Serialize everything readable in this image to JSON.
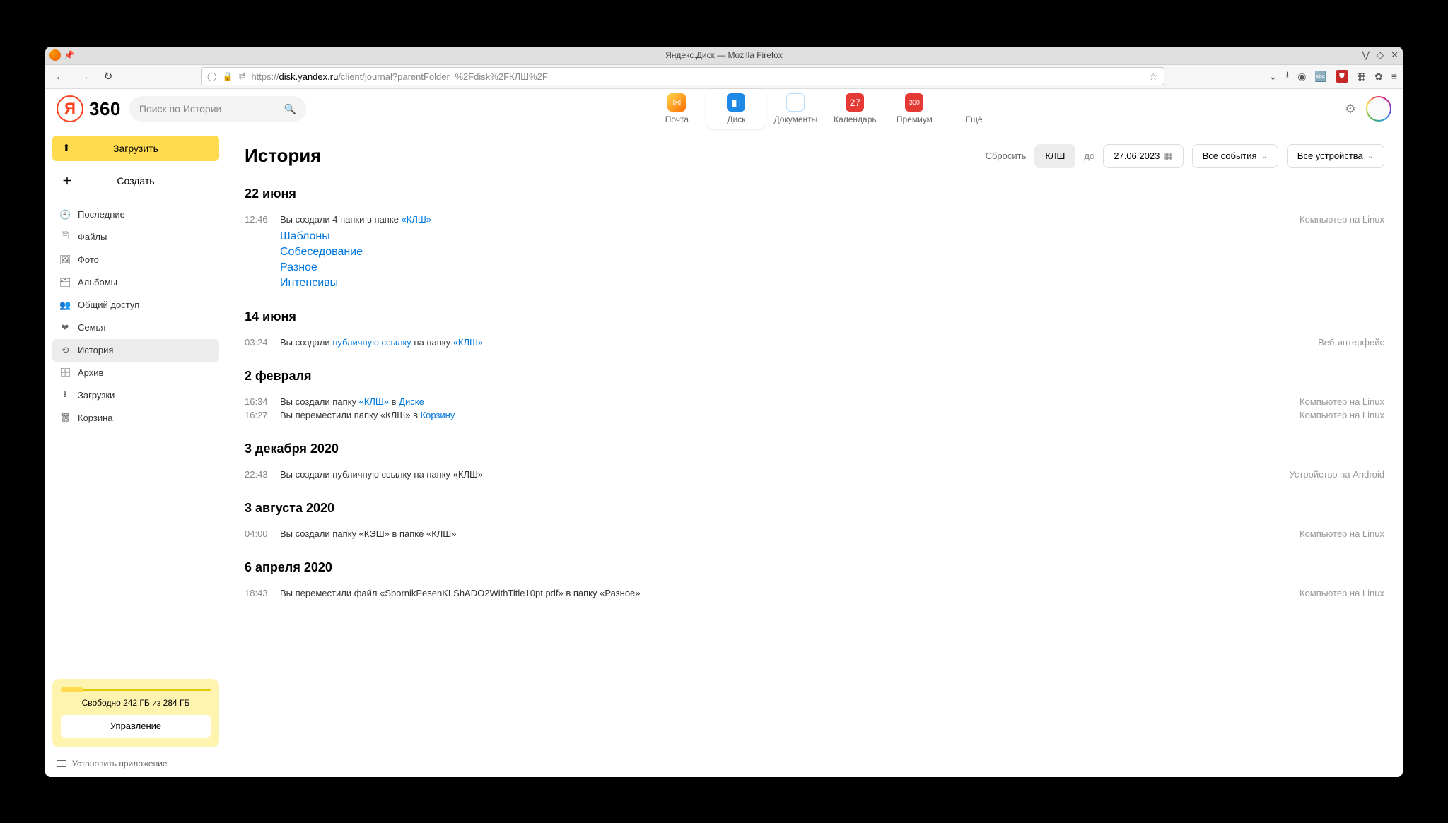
{
  "window": {
    "title": "Яндекс.Диск — Mozilla Firefox"
  },
  "urlbar": {
    "prefix": "https://",
    "host": "disk.yandex.ru",
    "path": "/client/journal?parentFolder=%2Fdisk%2FКЛШ%2F"
  },
  "app": {
    "logo_text": "360",
    "logo_letter": "Я",
    "search_placeholder": "Поиск по Истории"
  },
  "services": {
    "mail": "Почта",
    "disk": "Диск",
    "docs": "Документы",
    "calendar": "Календарь",
    "calendar_badge": "27",
    "premium": "Премиум",
    "premium_badge": "360",
    "more": "Ещё"
  },
  "sidebar": {
    "upload": "Загрузить",
    "create": "Создать",
    "items": {
      "recent": "Последние",
      "files": "Файлы",
      "photo": "Фото",
      "albums": "Альбомы",
      "shared": "Общий доступ",
      "family": "Семья",
      "history": "История",
      "archive": "Архив",
      "downloads": "Загрузки",
      "trash": "Корзина"
    },
    "storage_text": "Свободно 242 ГБ из 284 ГБ",
    "manage_btn": "Управление",
    "install": "Установить приложение"
  },
  "filters": {
    "reset": "Сбросить",
    "folder_chip": "КЛШ",
    "until": "до",
    "date": "27.06.2023",
    "all_events": "Все события",
    "all_devices": "Все устройства"
  },
  "journal": {
    "title": "История",
    "days": [
      {
        "title": "22 июня",
        "entries": [
          {
            "time": "12:46",
            "text_before": "Вы создали 4 папки в папке ",
            "link1": "«КЛШ»",
            "text_mid": "",
            "link2": "",
            "text_after": "",
            "device": "Компьютер на Linux",
            "sublinks": [
              "Шаблоны",
              "Собеседование",
              "Разное",
              "Интенсивы"
            ]
          }
        ]
      },
      {
        "title": "14 июня",
        "entries": [
          {
            "time": "03:24",
            "text_before": "Вы создали ",
            "link1": "публичную ссылку",
            "text_mid": " на папку ",
            "link2": "«КЛШ»",
            "text_after": "",
            "device": "Веб-интерфейс",
            "sublinks": []
          }
        ]
      },
      {
        "title": "2 февраля",
        "entries": [
          {
            "time": "16:34",
            "text_before": "Вы создали папку ",
            "link1": "«КЛШ»",
            "text_mid": " в ",
            "link2": "Диске",
            "text_after": "",
            "device": "Компьютер на Linux",
            "sublinks": []
          },
          {
            "time": "16:27",
            "text_before": "Вы переместили папку «КЛШ» в ",
            "link1": "Корзину",
            "text_mid": "",
            "link2": "",
            "text_after": "",
            "device": "Компьютер на Linux",
            "sublinks": []
          }
        ]
      },
      {
        "title": "3 декабря 2020",
        "entries": [
          {
            "time": "22:43",
            "text_before": "Вы создали публичную ссылку на папку «КЛШ»",
            "link1": "",
            "text_mid": "",
            "link2": "",
            "text_after": "",
            "device": "Устройство на Android",
            "sublinks": []
          }
        ]
      },
      {
        "title": "3 августа 2020",
        "entries": [
          {
            "time": "04:00",
            "text_before": "Вы создали папку «КЭШ» в папке «КЛШ»",
            "link1": "",
            "text_mid": "",
            "link2": "",
            "text_after": "",
            "device": "Компьютер на Linux",
            "sublinks": []
          }
        ]
      },
      {
        "title": "6 апреля 2020",
        "entries": [
          {
            "time": "18:43",
            "text_before": "Вы переместили файл «SbornikPesenKLShADO2WithTitle10pt.pdf» в папку «Разное»",
            "link1": "",
            "text_mid": "",
            "link2": "",
            "text_after": "",
            "device": "Компьютер на Linux",
            "sublinks": []
          }
        ]
      }
    ]
  }
}
